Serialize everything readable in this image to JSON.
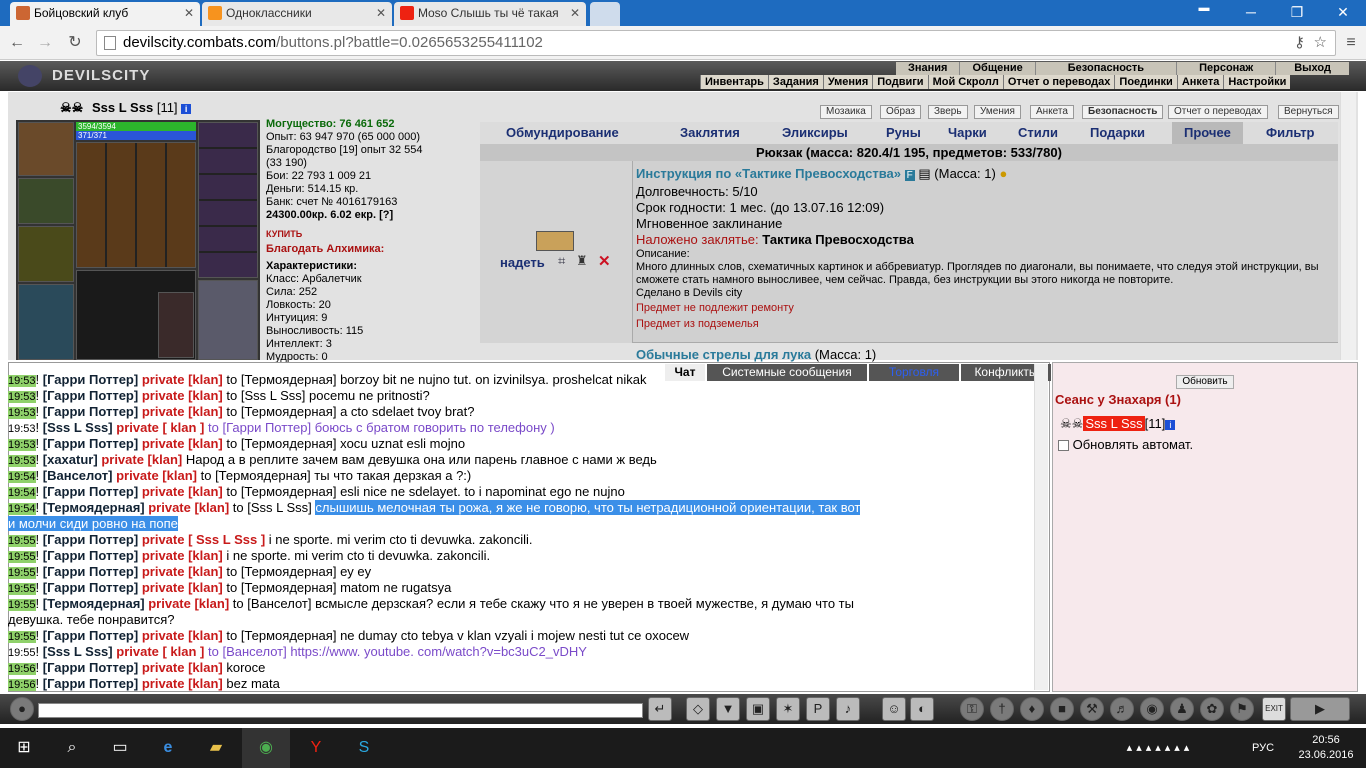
{
  "browser": {
    "tabs": [
      {
        "label": "Бойцовский клуб",
        "active": true
      },
      {
        "label": "Одноклассники",
        "active": false
      },
      {
        "label": "Moso Слышь ты чё такая",
        "active": false
      }
    ],
    "url": "devilscity.combats.com/buttons.pl?battle=0.0265653255411102",
    "url_host": "devilscity.combats.com",
    "url_path": "/buttons.pl?battle=0.0265653255411102"
  },
  "game": {
    "logo": "DEVILSCITY",
    "menu_main": [
      "Знания",
      "Общение",
      "Безопасность",
      "Персонаж",
      "Выход"
    ],
    "menu_sub": [
      "Инвентарь",
      "Задания",
      "Умения",
      "Подвиги",
      "Мой Скролл",
      "Отчет о переводах",
      "Поединки",
      "Анкета",
      "Настройки"
    ],
    "top_buttons": [
      "Мозаика",
      "Образ",
      "Зверь",
      "Умения",
      "Анкета",
      "Безопасность",
      "Отчет о переводах",
      "Вернуться"
    ],
    "character": {
      "name": "Sss L Sss",
      "level": "[11]",
      "hp": "3594/3594",
      "mana": "371/371"
    },
    "stats": {
      "power": "Могущество: 76 461 652",
      "exp": "Опыт: 63 947 970 (65 000 000)",
      "valor": "Благородство [19] опыт 32 554",
      "valor2": "(33 190)",
      "fights": "Бои:  22 793     1 009    21",
      "money": "Деньги: 514.15 кр.",
      "bank": "Банк: счет № 4016179163",
      "bank2": "24300.00кр. 6.02 екр. [?]",
      "buy": "КУПИТЬ",
      "blessing": "Благодать Алхимика:",
      "char_header": "Характеристики:",
      "class": "Класс: Арбалетчик",
      "str": "Сила: 252",
      "agi": "Ловкость: 20",
      "int": "Интуиция: 9",
      "end": "Выносливость: 115",
      "intel": "Интеллект: 3",
      "wis": "Мудрость: 0"
    },
    "inventory_tabs": [
      "Обмундирование",
      "Заклятия",
      "Эликсиры",
      "Руны",
      "Чарки",
      "Стили",
      "Подарки",
      "Прочее",
      "Фильтр"
    ],
    "bag": "Рюкзак (масса: 820.4/1 195, предметов: 533/780)",
    "item": {
      "action": "надеть",
      "title": "Инструкция по «Тактике Превосходства»",
      "mass": "(Масса: 1)",
      "durability": "Долговечность: 5/10",
      "expiry": "Срок годности: 1 мес. (до 13.07.16 12:09)",
      "instant": "Мгновенное заклинание",
      "spell_label": "Наложено заклятье:",
      "spell": "Тактика Превосходства",
      "desc_label": "Описание:",
      "desc": "Много длинных слов, схематичных картинок и аббревиатур. Проглядев по диагонали, вы понимаете, что следуя этой инструкции, вы сможете стать намного выносливее, чем сейчас. Правда, без инструкции вы этого никогда не повторите.",
      "made": "Сделано в Devils city",
      "norepair": "Предмет не подлежит ремонту",
      "from": "Предмет из подземелья"
    },
    "item2": {
      "title": "Обычные стрелы для лука",
      "mass": "(Масса: 1)"
    }
  },
  "chat": {
    "tabs": [
      "Чат",
      "Системные сообщения",
      "Торговля",
      "Конфликты"
    ],
    "lines": [
      {
        "t": "19:53",
        "from": "[Гарри Поттер]",
        "kind": "private [klan]",
        "to": "to [Термоядерная]",
        "msg": "borzoy bit ne nujno tut. on izvinilsya. proshelcat nikak"
      },
      {
        "t": "19:53",
        "from": "[Гарри Поттер]",
        "kind": "private [klan]",
        "to": "to [Sss L Sss]",
        "msg": "pocemu ne pritnosti?"
      },
      {
        "t": "19:53",
        "from": "[Гарри Поттер]",
        "kind": "private [klan]",
        "to": "to [Термоядерная]",
        "msg": "a cto sdelaet tvoy brat?"
      },
      {
        "t": "19:53",
        "from": "[Sss L Sss]",
        "kind": "private [ klan ]",
        "to": "to [Гарри Поттер]",
        "msg": "боюсь с братом говорить по телефону )",
        "self": true
      },
      {
        "t": "19:53",
        "from": "[Гарри Поттер]",
        "kind": "private [klan]",
        "to": "to [Термоядерная]",
        "msg": "xocu uznat esli mojno"
      },
      {
        "t": "19:53",
        "from": "[xaxatur]",
        "kind": "private [klan]",
        "to": "",
        "msg": "Народ а в реплите зачем вам девушка она или парень главное с нами ж ведь"
      },
      {
        "t": "19:54",
        "from": "[Ванселот]",
        "kind": "private [klan]",
        "to": "to [Термоядерная]",
        "msg": "ты что такая дерзкая а ?:)"
      },
      {
        "t": "19:54",
        "from": "[Гарри Поттер]",
        "kind": "private [klan]",
        "to": "to [Термоядерная]",
        "msg": "esli nice ne sdelayet. to i napominat ego ne nujno"
      },
      {
        "t": "19:54",
        "from": "[Термоядерная]",
        "kind": "private [klan]",
        "to": "to [Sss L Sss]",
        "msg": "слышишь мелочная ты рожа, я же не говорю, что ты нетрадиционной ориентации, так вот",
        "msg2": "и молчи сиди ровно на попе",
        "hl": true
      },
      {
        "t": "19:55",
        "from": "[Гарри Поттер]",
        "kind": "private [ Sss L Sss ]",
        "to": "",
        "msg": "i ne sporte. mi verim cto ti devuwka. zakoncili."
      },
      {
        "t": "19:55",
        "from": "[Гарри Поттер]",
        "kind": "private [klan]",
        "to": "",
        "msg": "i ne sporte. mi verim cto ti devuwka. zakoncili."
      },
      {
        "t": "19:55",
        "from": "[Гарри Поттер]",
        "kind": "private [klan]",
        "to": "to [Термоядерная]",
        "msg": "ey ey"
      },
      {
        "t": "19:55",
        "from": "[Гарри Поттер]",
        "kind": "private [klan]",
        "to": "to [Термоядерная]",
        "msg": "matom ne rugatsya"
      },
      {
        "t": "19:55",
        "from": "[Термоядерная]",
        "kind": "private [klan]",
        "to": "to [Ванселот]",
        "msg": "всмысле дерзская? если я тебе скажу что я не уверен в твоей мужестве, я думаю что ты",
        "msg2": "девушка. тебе понравится?"
      },
      {
        "t": "19:55",
        "from": "[Гарри Поттер]",
        "kind": "private [klan]",
        "to": "to [Термоядерная]",
        "msg": "ne dumay cto tebya v klan vzyali i mojew nesti tut ce oxocew"
      },
      {
        "t": "19:55",
        "from": "[Sss L Sss]",
        "kind": "private [ klan ]",
        "to": "to [Ванселот]",
        "msg": "https://www. youtube. com/watch?v=bc3uC2_vDHY",
        "self": true
      },
      {
        "t": "19:56",
        "from": "[Гарри Поттер]",
        "kind": "private [klan]",
        "to": "",
        "msg": "koroce"
      },
      {
        "t": "19:56",
        "from": "[Гарри Поттер]",
        "kind": "private [klan]",
        "to": "",
        "msg": "bez mata"
      }
    ]
  },
  "right_panel": {
    "refresh": "Обновить",
    "title": "Сеанс у Знахаря (1)",
    "user": "Sss L Sss",
    "level": "[11]",
    "auto": "Обновлять автомат."
  },
  "taskbar": {
    "lang": "РУС",
    "time": "20:56",
    "date": "23.06.2016"
  }
}
